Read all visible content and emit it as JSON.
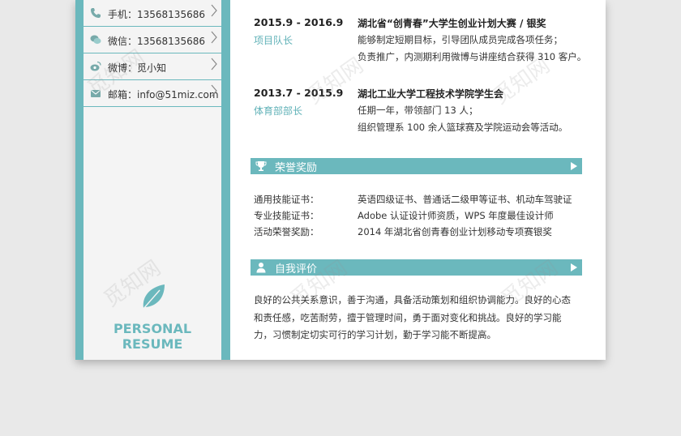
{
  "contacts": [
    {
      "icon": "phone-icon",
      "label": "手机：13568135686"
    },
    {
      "icon": "wechat-icon",
      "label": "微信：13568135686"
    },
    {
      "icon": "weibo-icon",
      "label": "微博：觅小知"
    },
    {
      "icon": "mail-icon",
      "label": "邮箱：info@51miz.com"
    }
  ],
  "brand": "PERSONAL RESUME",
  "experience": [
    {
      "period": "2015.9 - 2016.9",
      "role": "项目队长",
      "title": "湖北省“创青春”大学生创业计划大赛 / 银奖",
      "lines": [
        "能够制定短期目标，引导团队成员完成各项任务；",
        "负责推广，内测期利用微博与讲座结合获得 310 客户。"
      ]
    },
    {
      "period": "2013.7 - 2015.9",
      "role": "体育部部长",
      "title": "湖北工业大学工程技术学院学生会",
      "lines": [
        "任期一年，带领部门 13 人；",
        "组织管理系 100 余人篮球赛及学院运动会等活动。"
      ]
    }
  ],
  "honors": {
    "heading": "荣誉奖励",
    "items": [
      {
        "label": "通用技能证书：",
        "value": "英语四级证书、普通话二级甲等证书、机动车驾驶证"
      },
      {
        "label": "专业技能证书：",
        "value": "Adobe 认证设计师资质，WPS 年度最佳设计师"
      },
      {
        "label": "活动荣誉奖励：",
        "value": "2014 年湖北省创青春创业计划移动专项赛银奖"
      }
    ]
  },
  "self_eval": {
    "heading": "自我评价",
    "lines": [
      "良好的公共关系意识，善于沟通，具备活动策划和组织协调能力。良好的心态",
      "和责任感，吃苦耐劳，擅于管理时间，勇于面对变化和挑战。良好的学习能",
      "力，习惯制定切实可行的学习计划，勤于学习能不断提高。"
    ]
  },
  "colors": {
    "accent": "#6bb8bd",
    "sidebar_bg": "#f4f4f4"
  },
  "watermark": "觅知网"
}
